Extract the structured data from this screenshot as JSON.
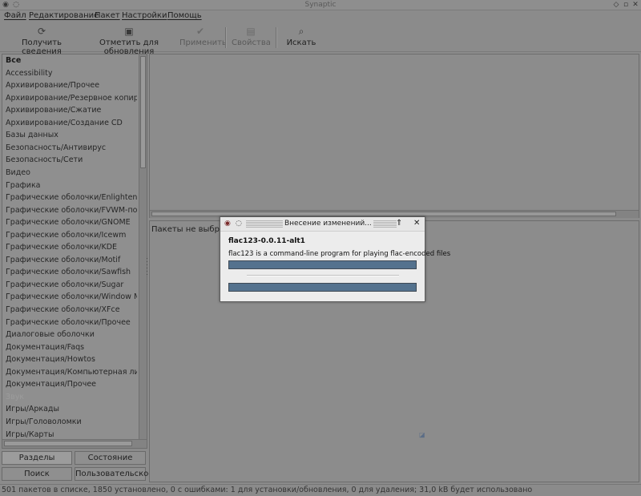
{
  "window": {
    "title": "Synaptic",
    "icons": {
      "app": "synaptic-app-icon",
      "menu": "window-menu-icon",
      "shade": "shade-icon",
      "maximize": "maximize-icon",
      "close": "close-icon"
    }
  },
  "menubar": {
    "items": [
      "Файл",
      "Редактирование",
      "Пакет",
      "Настройки",
      "Помощь"
    ]
  },
  "toolbar": {
    "reload_label": "Получить сведения",
    "upgrade_label": "Отметить для обновления",
    "apply_label": "Применить",
    "properties_label": "Свойства",
    "search_label": "Искать"
  },
  "sidebar": {
    "categories": [
      "Все",
      "Accessibility",
      "Архивирование/Прочее",
      "Архивирование/Резервное копирование",
      "Архивирование/Сжатие",
      "Архивирование/Создание CD",
      "Базы данных",
      "Безопасность/Антивирус",
      "Безопасность/Сети",
      "Видео",
      "Графика",
      "Графические оболочки/Enlightenment",
      "Графические оболочки/FVWM-подобные",
      "Графические оболочки/GNOME",
      "Графические оболочки/Icewm",
      "Графические оболочки/KDE",
      "Графические оболочки/Motif",
      "Графические оболочки/Sawfish",
      "Графические оболочки/Sugar",
      "Графические оболочки/Window Maker",
      "Графические оболочки/XFce",
      "Графические оболочки/Прочее",
      "Диалоговые оболочки",
      "Документация/Faqs",
      "Документация/Howtos",
      "Документация/Компьютерная литература",
      "Документация/Прочее",
      "Звук",
      "Игры/Аркады",
      "Игры/Головоломки",
      "Игры/Карты"
    ],
    "buttons": {
      "sections": "Разделы",
      "status": "Состояние",
      "search": "Поиск",
      "custom": "Пользовательское"
    }
  },
  "details": {
    "no_selection": "Пакеты не выбраны"
  },
  "statusbar": {
    "text": "501 пакетов в списке, 1850 установлено, 0 с ошибками: 1 для установки/обновления, 0 для удаления; 31,0 kB будет использовано"
  },
  "dialog": {
    "title": "Внесение изменений...",
    "package_name": "flac123-0.0.11-alt1",
    "package_desc": "flac123 is a command-line program for playing flac-encoded files",
    "progress_top": 1.0,
    "progress_bottom": 1.0,
    "colors": {
      "progress": "#54728e"
    }
  }
}
